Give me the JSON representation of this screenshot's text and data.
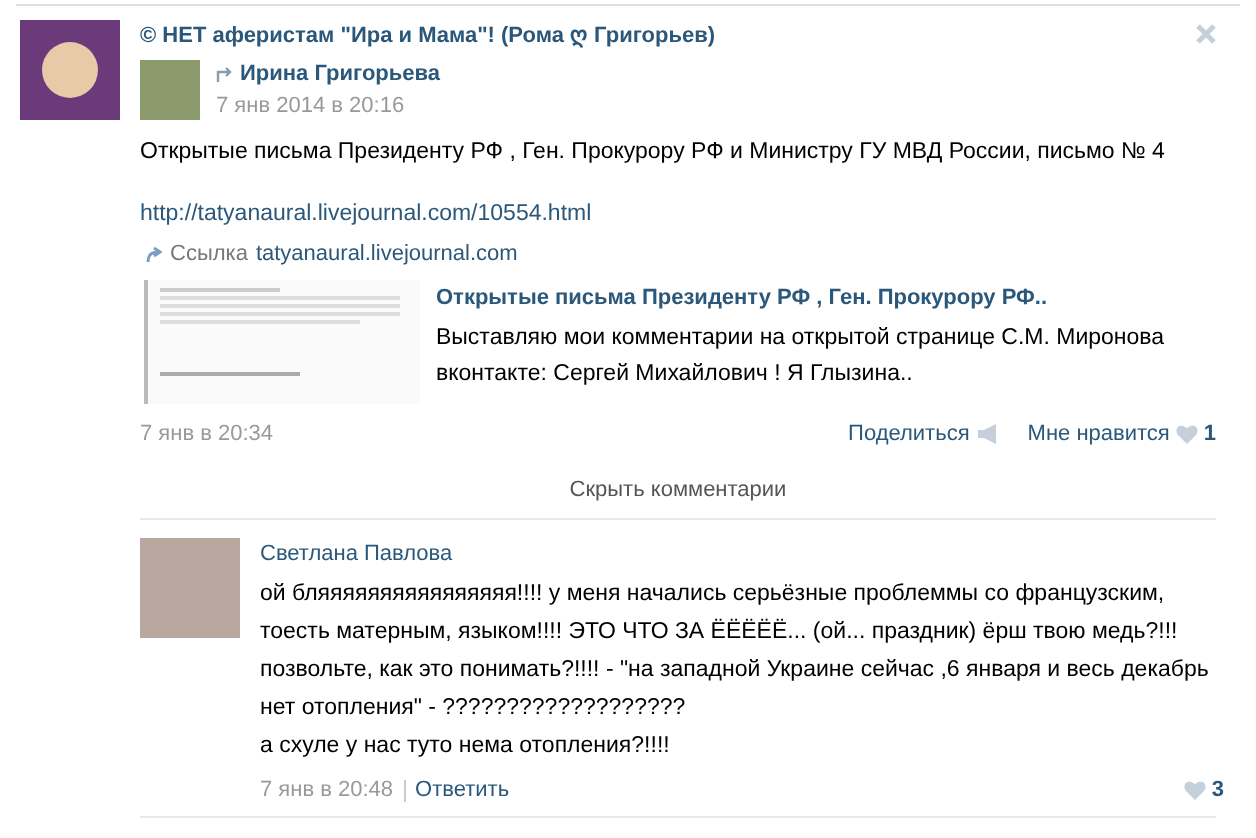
{
  "post": {
    "group_title": "© НЕТ аферистам \"Ира и Мама\"! (Рома ღ Григорьев)",
    "repost": {
      "author": "Ирина Григорьева",
      "date": "7 янв 2014 в 20:16"
    },
    "text": "Открытые письма Президенту РФ , Ген. Прокурору РФ и Министру ГУ МВД России, письмо № 4",
    "url": "http://tatyanaural.livejournal.com/10554.html",
    "link_label": "Ссылка",
    "link_domain": "tatyanaural.livejournal.com",
    "preview": {
      "title": "Открытые письма Президенту РФ , Ген. Прокурору РФ..",
      "description": "Выставляю мои комментарии на открытой странице С.М. Миронова вконтакте: Сергей Михайлович ! Я Глызина.."
    },
    "date": "7 янв в 20:34",
    "share": "Поделиться",
    "like": "Мне нравится",
    "like_count": "1"
  },
  "hide_comments": "Скрыть комментарии",
  "comments": [
    {
      "author": "Светлана Павлова",
      "text": "ой бляяяяяяяяяяяяяяяя!!!! у меня начались серьёзные проблеммы со французским, тоесть матерным, языком!!!! ЭТО ЧТО ЗА ЁЁЁЁЁ... (ой... праздник) ёрш твою медь?!!! позвольте, как это понимать?!!!! - \"на западной Украине сейчас ,6 января и весь декабрь нет отопления\" - ???????????????????\nа схуле у нас туто нема отопления?!!!!",
      "date": "7 янв в 20:48",
      "reply": "Ответить",
      "like_count": "3"
    }
  ]
}
